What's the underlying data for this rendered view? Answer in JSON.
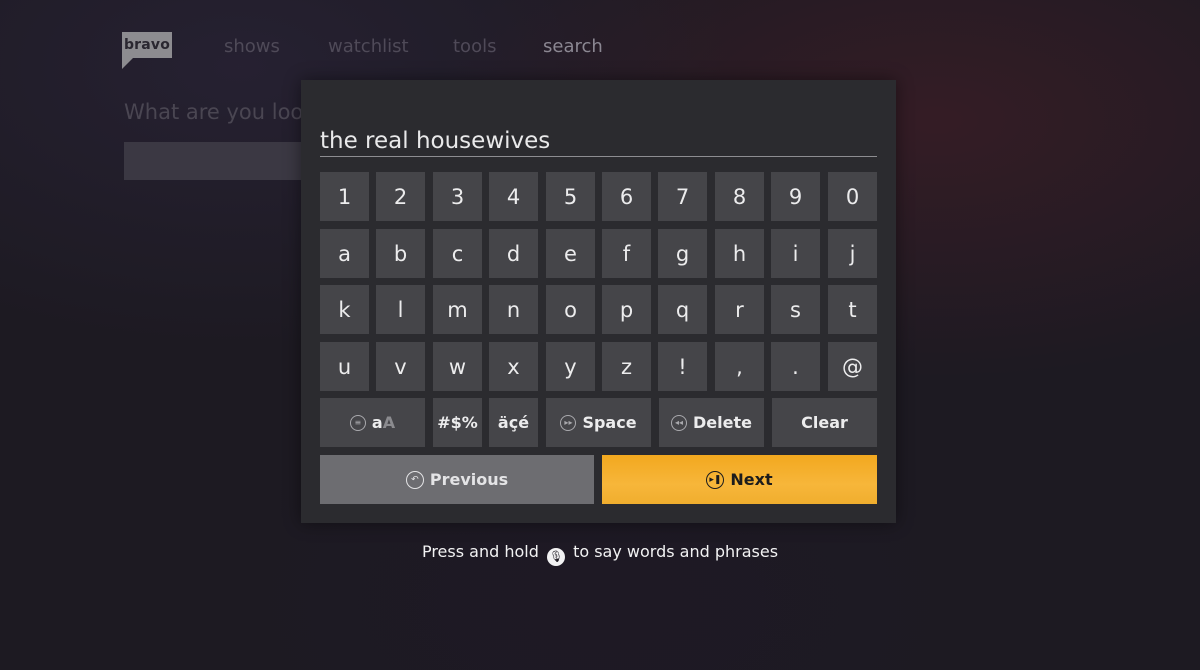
{
  "app": {
    "logo_text": "bravo",
    "nav": [
      {
        "label": "shows",
        "active": false
      },
      {
        "label": "watchlist",
        "active": false
      },
      {
        "label": "tools",
        "active": false
      },
      {
        "label": "search",
        "active": true
      }
    ],
    "search_prompt": "What are you look"
  },
  "keyboard": {
    "query": "the real housewives",
    "rows": [
      [
        "1",
        "2",
        "3",
        "4",
        "5",
        "6",
        "7",
        "8",
        "9",
        "0"
      ],
      [
        "a",
        "b",
        "c",
        "d",
        "e",
        "f",
        "g",
        "h",
        "i",
        "j"
      ],
      [
        "k",
        "l",
        "m",
        "n",
        "o",
        "p",
        "q",
        "r",
        "s",
        "t"
      ],
      [
        "u",
        "v",
        "w",
        "x",
        "y",
        "z",
        "!",
        ",",
        ".",
        "@"
      ]
    ],
    "function_keys": {
      "case_lower": "a",
      "case_upper": "A",
      "symbols": "#$%",
      "accents": "äçé",
      "space": "Space",
      "delete": "Delete",
      "clear": "Clear"
    },
    "previous_label": "Previous",
    "next_label": "Next"
  },
  "hint": {
    "before": "Press and hold",
    "after": "to say words and phrases"
  },
  "colors": {
    "accent": "#f5b02e",
    "key_bg": "#454549",
    "panel_bg": "#2b2b2f"
  },
  "icons": {
    "case_toggle": "menu-icon",
    "space": "fast-forward-icon",
    "delete": "rewind-icon",
    "previous": "back-icon",
    "next": "play-pause-icon",
    "voice": "microphone-icon"
  }
}
